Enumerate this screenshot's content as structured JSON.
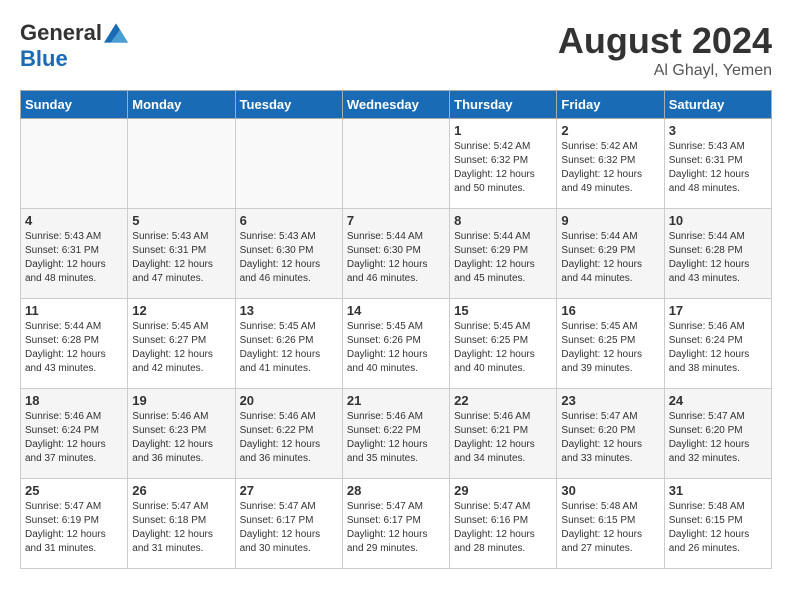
{
  "logo": {
    "general": "General",
    "blue": "Blue"
  },
  "title": {
    "month_year": "August 2024",
    "location": "Al Ghayl, Yemen"
  },
  "weekdays": [
    "Sunday",
    "Monday",
    "Tuesday",
    "Wednesday",
    "Thursday",
    "Friday",
    "Saturday"
  ],
  "weeks": [
    [
      {
        "day": "",
        "info": ""
      },
      {
        "day": "",
        "info": ""
      },
      {
        "day": "",
        "info": ""
      },
      {
        "day": "",
        "info": ""
      },
      {
        "day": "1",
        "info": "Sunrise: 5:42 AM\nSunset: 6:32 PM\nDaylight: 12 hours\nand 50 minutes."
      },
      {
        "day": "2",
        "info": "Sunrise: 5:42 AM\nSunset: 6:32 PM\nDaylight: 12 hours\nand 49 minutes."
      },
      {
        "day": "3",
        "info": "Sunrise: 5:43 AM\nSunset: 6:31 PM\nDaylight: 12 hours\nand 48 minutes."
      }
    ],
    [
      {
        "day": "4",
        "info": "Sunrise: 5:43 AM\nSunset: 6:31 PM\nDaylight: 12 hours\nand 48 minutes."
      },
      {
        "day": "5",
        "info": "Sunrise: 5:43 AM\nSunset: 6:31 PM\nDaylight: 12 hours\nand 47 minutes."
      },
      {
        "day": "6",
        "info": "Sunrise: 5:43 AM\nSunset: 6:30 PM\nDaylight: 12 hours\nand 46 minutes."
      },
      {
        "day": "7",
        "info": "Sunrise: 5:44 AM\nSunset: 6:30 PM\nDaylight: 12 hours\nand 46 minutes."
      },
      {
        "day": "8",
        "info": "Sunrise: 5:44 AM\nSunset: 6:29 PM\nDaylight: 12 hours\nand 45 minutes."
      },
      {
        "day": "9",
        "info": "Sunrise: 5:44 AM\nSunset: 6:29 PM\nDaylight: 12 hours\nand 44 minutes."
      },
      {
        "day": "10",
        "info": "Sunrise: 5:44 AM\nSunset: 6:28 PM\nDaylight: 12 hours\nand 43 minutes."
      }
    ],
    [
      {
        "day": "11",
        "info": "Sunrise: 5:44 AM\nSunset: 6:28 PM\nDaylight: 12 hours\nand 43 minutes."
      },
      {
        "day": "12",
        "info": "Sunrise: 5:45 AM\nSunset: 6:27 PM\nDaylight: 12 hours\nand 42 minutes."
      },
      {
        "day": "13",
        "info": "Sunrise: 5:45 AM\nSunset: 6:26 PM\nDaylight: 12 hours\nand 41 minutes."
      },
      {
        "day": "14",
        "info": "Sunrise: 5:45 AM\nSunset: 6:26 PM\nDaylight: 12 hours\nand 40 minutes."
      },
      {
        "day": "15",
        "info": "Sunrise: 5:45 AM\nSunset: 6:25 PM\nDaylight: 12 hours\nand 40 minutes."
      },
      {
        "day": "16",
        "info": "Sunrise: 5:45 AM\nSunset: 6:25 PM\nDaylight: 12 hours\nand 39 minutes."
      },
      {
        "day": "17",
        "info": "Sunrise: 5:46 AM\nSunset: 6:24 PM\nDaylight: 12 hours\nand 38 minutes."
      }
    ],
    [
      {
        "day": "18",
        "info": "Sunrise: 5:46 AM\nSunset: 6:24 PM\nDaylight: 12 hours\nand 37 minutes."
      },
      {
        "day": "19",
        "info": "Sunrise: 5:46 AM\nSunset: 6:23 PM\nDaylight: 12 hours\nand 36 minutes."
      },
      {
        "day": "20",
        "info": "Sunrise: 5:46 AM\nSunset: 6:22 PM\nDaylight: 12 hours\nand 36 minutes."
      },
      {
        "day": "21",
        "info": "Sunrise: 5:46 AM\nSunset: 6:22 PM\nDaylight: 12 hours\nand 35 minutes."
      },
      {
        "day": "22",
        "info": "Sunrise: 5:46 AM\nSunset: 6:21 PM\nDaylight: 12 hours\nand 34 minutes."
      },
      {
        "day": "23",
        "info": "Sunrise: 5:47 AM\nSunset: 6:20 PM\nDaylight: 12 hours\nand 33 minutes."
      },
      {
        "day": "24",
        "info": "Sunrise: 5:47 AM\nSunset: 6:20 PM\nDaylight: 12 hours\nand 32 minutes."
      }
    ],
    [
      {
        "day": "25",
        "info": "Sunrise: 5:47 AM\nSunset: 6:19 PM\nDaylight: 12 hours\nand 31 minutes."
      },
      {
        "day": "26",
        "info": "Sunrise: 5:47 AM\nSunset: 6:18 PM\nDaylight: 12 hours\nand 31 minutes."
      },
      {
        "day": "27",
        "info": "Sunrise: 5:47 AM\nSunset: 6:17 PM\nDaylight: 12 hours\nand 30 minutes."
      },
      {
        "day": "28",
        "info": "Sunrise: 5:47 AM\nSunset: 6:17 PM\nDaylight: 12 hours\nand 29 minutes."
      },
      {
        "day": "29",
        "info": "Sunrise: 5:47 AM\nSunset: 6:16 PM\nDaylight: 12 hours\nand 28 minutes."
      },
      {
        "day": "30",
        "info": "Sunrise: 5:48 AM\nSunset: 6:15 PM\nDaylight: 12 hours\nand 27 minutes."
      },
      {
        "day": "31",
        "info": "Sunrise: 5:48 AM\nSunset: 6:15 PM\nDaylight: 12 hours\nand 26 minutes."
      }
    ]
  ]
}
